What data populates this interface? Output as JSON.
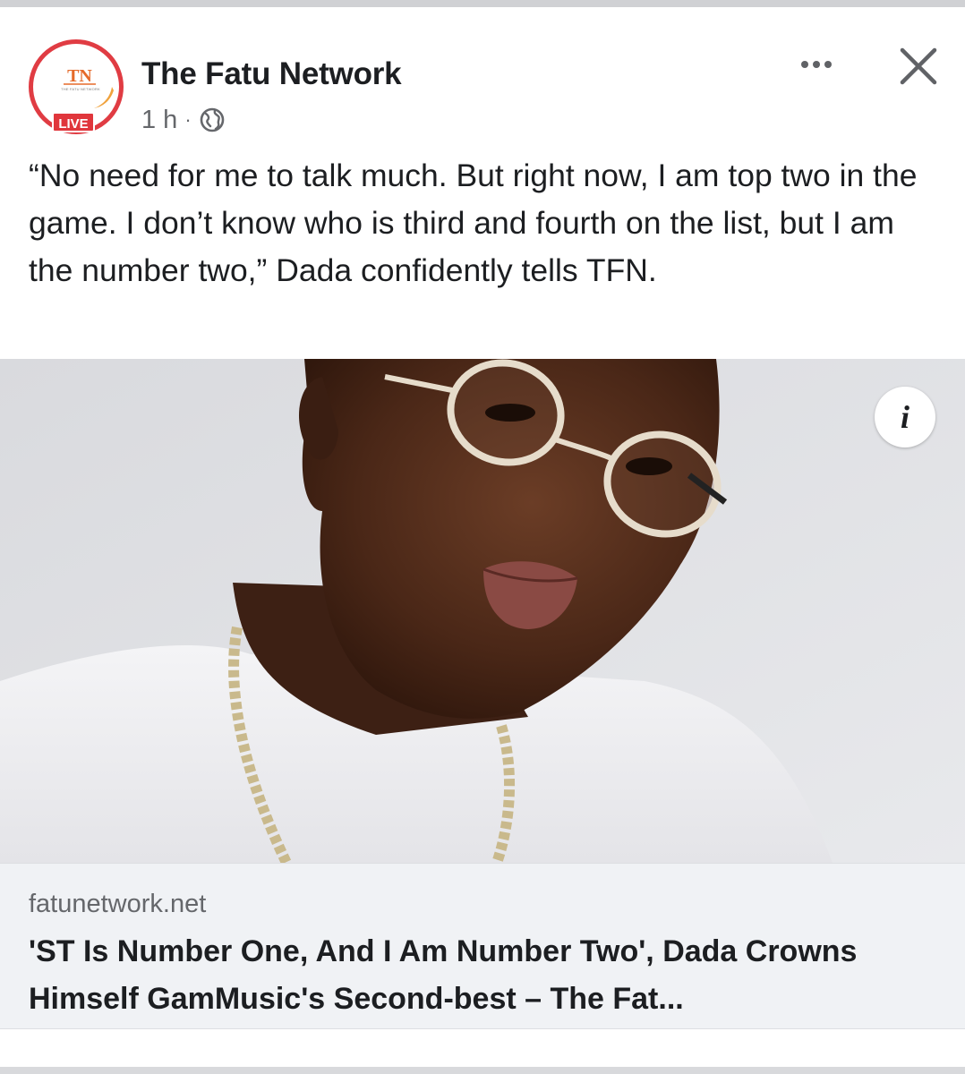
{
  "post": {
    "page_name": "The Fatu Network",
    "timestamp": "1 h",
    "separator": "·",
    "audience_icon": "globe-icon",
    "avatar": {
      "logo_text": "TN",
      "logo_subtext": "THE FATU NETWORK",
      "live_label": "LIVE",
      "ring_color": "#e03c43",
      "badge_color": "#e0363c"
    },
    "body_text": "“No need for me to talk much. But right now, I am top two in the game. I don’t know who is third and fourth on the list, but I am the number two,” Dada confidently tells TFN.",
    "info_label": "i"
  },
  "link_preview": {
    "domain": "fatunetwork.net",
    "title": "'ST Is Number One, And I Am Number Two', Dada Crowns Himself GamMusic's Second-best – The Fat..."
  },
  "colors": {
    "text_primary": "#1c1e21",
    "text_secondary": "#65676b",
    "card_background": "#f0f2f5"
  }
}
